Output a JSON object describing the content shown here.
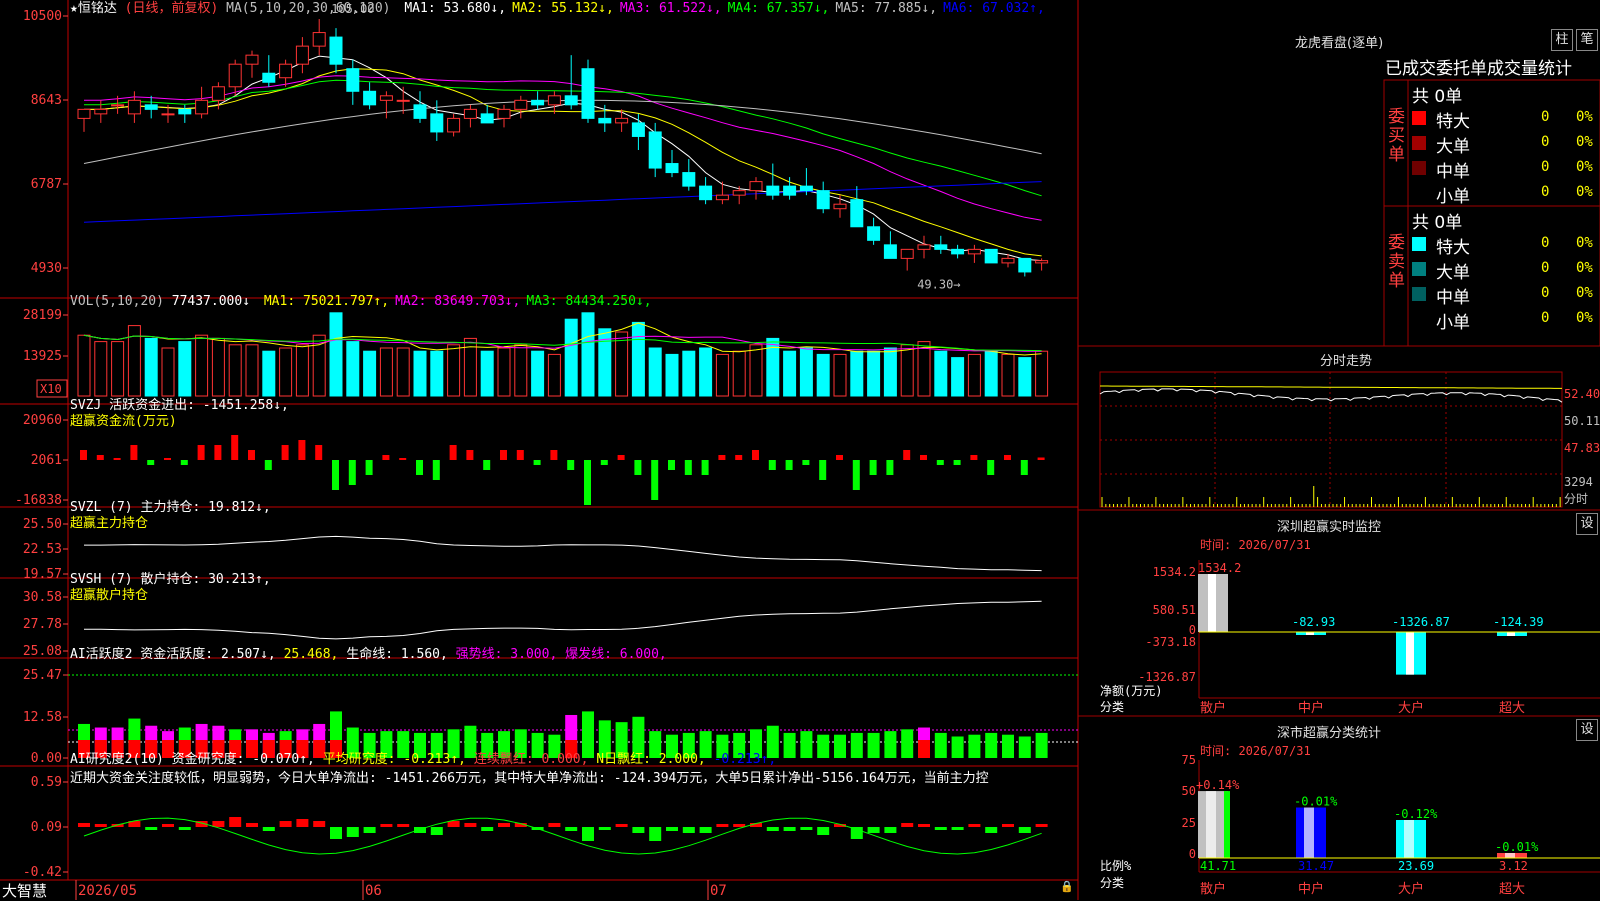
{
  "app": {
    "name": "大智慧"
  },
  "stock": {
    "name": "★恒铭达",
    "mode": "(日线，前复权)"
  },
  "colors": {
    "up": "#ff3333",
    "down": "#00ffff",
    "bg": "#000000",
    "grid": "#a00000",
    "ma1": "#ffffff",
    "ma2": "#ffff00",
    "ma3": "#ff00ff",
    "ma4": "#00ff00",
    "ma5": "#c0c0c0",
    "ma6": "#0000ff"
  },
  "price_panel": {
    "y_labels": [
      "10500",
      "8643",
      "6787",
      "4930"
    ],
    "ma_title": "MA(5,10,20,30,60,120)",
    "ma": [
      {
        "name": "MA1",
        "value": "53.680",
        "arrow": "↓",
        "color": "#ffffff"
      },
      {
        "name": "MA2",
        "value": "55.132",
        "arrow": "↓",
        "color": "#ffff00"
      },
      {
        "name": "MA3",
        "value": "61.522",
        "arrow": "↓",
        "color": "#ff00ff"
      },
      {
        "name": "MA4",
        "value": "67.357",
        "arrow": "↓",
        "color": "#00ff00"
      },
      {
        "name": "MA5",
        "value": "77.885",
        "arrow": "↓",
        "color": "#c0c0c0"
      },
      {
        "name": "MA6",
        "value": "67.032",
        "arrow": "↑",
        "color": "#0000ff"
      }
    ],
    "high_label": "105.00",
    "low_label": "49.30"
  },
  "vol_panel": {
    "y_labels": [
      "28199",
      "13925"
    ],
    "multiplier": "X10",
    "title": "VOL(5,10,20)",
    "value": "77437.000↓",
    "ma": [
      {
        "name": "MA1",
        "value": "75021.797",
        "arrow": "↑",
        "color": "#ffff00"
      },
      {
        "name": "MA2",
        "value": "83649.703",
        "arrow": "↓",
        "color": "#ff00ff"
      },
      {
        "name": "MA3",
        "value": "84434.250",
        "arrow": "↓",
        "color": "#00ff00"
      }
    ]
  },
  "svzj_panel": {
    "y_labels": [
      "20960",
      "2061",
      "-16838"
    ],
    "title": "SVZJ  活跃资金进出: -1451.258↓,",
    "subtitle": "超赢资金流(万元)"
  },
  "svzl_panel": {
    "y_labels": [
      "25.50",
      "22.53",
      "19.57"
    ],
    "title": "SVZL (7) 主力持仓: 19.812↓,",
    "subtitle": "超赢主力持仓"
  },
  "svsh_panel": {
    "y_labels": [
      "30.58",
      "27.78",
      "25.08"
    ],
    "title": "SVSH (7) 散户持仓: 30.213↑,",
    "subtitle": "超赢散户持仓"
  },
  "ai_active_panel": {
    "y_labels": [
      "25.47",
      "12.58",
      "0.00"
    ],
    "title": "AI活跃度2 资金活跃度: 2.507↓,",
    "value2": "25.468,",
    "lifeline": "生命线: 1.560,",
    "strong": "强势线: 3.000,",
    "burst": "爆发线: 6.000,"
  },
  "ai_research_panel": {
    "y_labels": [
      "0.59",
      "0.09",
      "-0.42"
    ],
    "title": "AI研究度2(10) 资金研究度: -0.070↑,",
    "avg": "平均研究度: -0.213↑,",
    "cont": "连续飘红: 0.000,",
    "nday": "N日飘红: 2.000,",
    "last": "-0.213↑,",
    "commentary": "近期大资金关注度较低，明显弱势，今日大单净流出: -1451.266万元，其中特大单净流出: -124.394万元，大单5日累计净出-5156.164万元，当前主力控"
  },
  "x_axis": {
    "labels": [
      "2026/05",
      "06",
      "07"
    ]
  },
  "longhu": {
    "title": "龙虎看盘(逐单)",
    "tabs": [
      "柱",
      "笔"
    ],
    "section_title": "已成交委托单成交量统计",
    "buy": {
      "label": "委买单",
      "total": "共 0单",
      "rows": [
        {
          "name": "特大",
          "count": "0",
          "pct": "0%",
          "color": "#ff0000"
        },
        {
          "name": "大单",
          "count": "0",
          "pct": "0%",
          "color": "#a00000"
        },
        {
          "name": "中单",
          "count": "0",
          "pct": "0%",
          "color": "#700000"
        },
        {
          "name": "小单",
          "count": "0",
          "pct": "0%",
          "color": "#000000"
        }
      ]
    },
    "sell": {
      "label": "委卖单",
      "total": "共 0单",
      "rows": [
        {
          "name": "特大",
          "count": "0",
          "pct": "0%",
          "color": "#00ffff"
        },
        {
          "name": "大单",
          "count": "0",
          "pct": "0%",
          "color": "#008080"
        },
        {
          "name": "中单",
          "count": "0",
          "pct": "0%",
          "color": "#006060"
        },
        {
          "name": "小单",
          "count": "0",
          "pct": "0%",
          "color": "#000000"
        }
      ]
    }
  },
  "intraday": {
    "title": "分时走势",
    "y_labels": [
      "52.40",
      "50.11",
      "47.83",
      "3294",
      "分时"
    ]
  },
  "sz_monitor": {
    "title": "深圳超赢实时监控",
    "settings": "设",
    "time": "时间: 2026/07/31",
    "y_labels": [
      "1534.2",
      "580.51",
      "0",
      "-373.18",
      "-1326.87"
    ],
    "axis_title": "净额(万元)",
    "axis_sub": "分类",
    "categories": [
      "散户",
      "中户",
      "大户",
      "超大"
    ],
    "values": [
      "1534.2",
      "-82.93",
      "-1326.87",
      "-124.39"
    ]
  },
  "sz_class": {
    "title": "深市超赢分类统计",
    "settings": "设",
    "time": "时间: 2026/07/31",
    "y_labels": [
      "75",
      "50",
      "25",
      "0"
    ],
    "axis_title": "比例%",
    "axis_sub": "分类",
    "categories": [
      "散户",
      "中户",
      "大户",
      "超大"
    ],
    "bars": [
      "41.71",
      "31.47",
      "23.69",
      "3.12"
    ],
    "changes": [
      "+0.14%",
      "-0.01%",
      "-0.12%",
      "-0.01%"
    ]
  },
  "chart_data": {
    "type": "candlestick",
    "ohlc": [
      [
        83,
        85,
        80,
        85
      ],
      [
        84,
        87,
        82,
        85
      ],
      [
        86,
        88,
        84,
        86
      ],
      [
        84,
        89,
        82,
        87
      ],
      [
        86,
        88,
        83,
        85
      ],
      [
        84,
        86,
        82,
        84
      ],
      [
        85,
        86,
        82,
        84
      ],
      [
        84,
        90,
        83,
        87
      ],
      [
        87,
        91,
        85,
        90
      ],
      [
        90,
        96,
        88,
        95
      ],
      [
        95,
        98,
        92,
        97
      ],
      [
        93,
        97,
        90,
        91
      ],
      [
        92,
        96,
        90,
        95
      ],
      [
        95,
        101,
        93,
        99
      ],
      [
        99,
        105,
        97,
        102
      ],
      [
        101,
        103,
        93,
        95
      ],
      [
        94,
        96,
        86,
        89
      ],
      [
        89,
        91,
        85,
        86
      ],
      [
        87,
        89,
        83,
        88
      ],
      [
        87,
        90,
        84,
        87
      ],
      [
        86,
        89,
        82,
        83
      ],
      [
        84,
        87,
        78,
        80
      ],
      [
        80,
        84,
        79,
        83
      ],
      [
        83,
        86,
        81,
        85
      ],
      [
        84,
        86,
        82,
        82
      ],
      [
        83,
        86,
        81,
        85
      ],
      [
        85,
        88,
        83,
        87
      ],
      [
        87,
        89,
        85,
        86
      ],
      [
        86,
        89,
        84,
        88
      ],
      [
        88,
        97,
        85,
        86
      ],
      [
        94,
        96,
        82,
        83
      ],
      [
        83,
        86,
        80,
        82
      ],
      [
        82,
        85,
        80,
        83
      ],
      [
        82,
        84,
        76,
        79
      ],
      [
        80,
        82,
        70,
        72
      ],
      [
        73,
        76,
        70,
        71
      ],
      [
        71,
        74,
        67,
        68
      ],
      [
        68,
        70,
        64,
        65
      ],
      [
        65,
        69,
        64,
        66
      ],
      [
        66,
        68,
        64,
        67
      ],
      [
        67,
        70,
        65,
        69
      ],
      [
        68,
        73,
        65,
        66
      ],
      [
        68,
        70,
        65,
        66
      ],
      [
        68,
        72,
        66,
        67
      ],
      [
        67,
        69,
        62,
        63
      ],
      [
        63,
        66,
        61,
        64
      ],
      [
        65,
        68,
        59,
        59
      ],
      [
        59,
        61,
        55,
        56
      ],
      [
        55,
        58,
        52,
        52
      ],
      [
        52,
        54,
        49.3,
        54
      ],
      [
        54,
        57,
        52,
        55
      ],
      [
        55,
        57,
        53,
        54
      ],
      [
        54,
        55,
        52,
        53
      ],
      [
        53,
        55,
        51,
        54
      ],
      [
        54,
        54,
        51,
        51
      ],
      [
        51,
        53,
        50,
        52
      ],
      [
        52,
        52,
        48,
        49
      ],
      [
        51,
        52,
        49.3,
        51.5
      ]
    ],
    "volume": [
      19,
      17,
      17,
      22,
      18,
      15,
      17,
      19,
      18,
      16,
      16,
      14,
      15,
      16,
      19,
      26,
      17,
      14,
      15,
      15,
      14,
      14,
      16,
      18,
      14,
      15,
      16,
      14,
      13,
      24,
      26,
      21,
      20,
      23,
      15,
      13,
      14,
      15,
      13,
      14,
      16,
      18,
      14,
      15,
      13,
      13,
      14,
      14,
      15,
      16,
      17,
      14,
      12,
      13,
      14,
      13,
      12,
      14
    ]
  }
}
